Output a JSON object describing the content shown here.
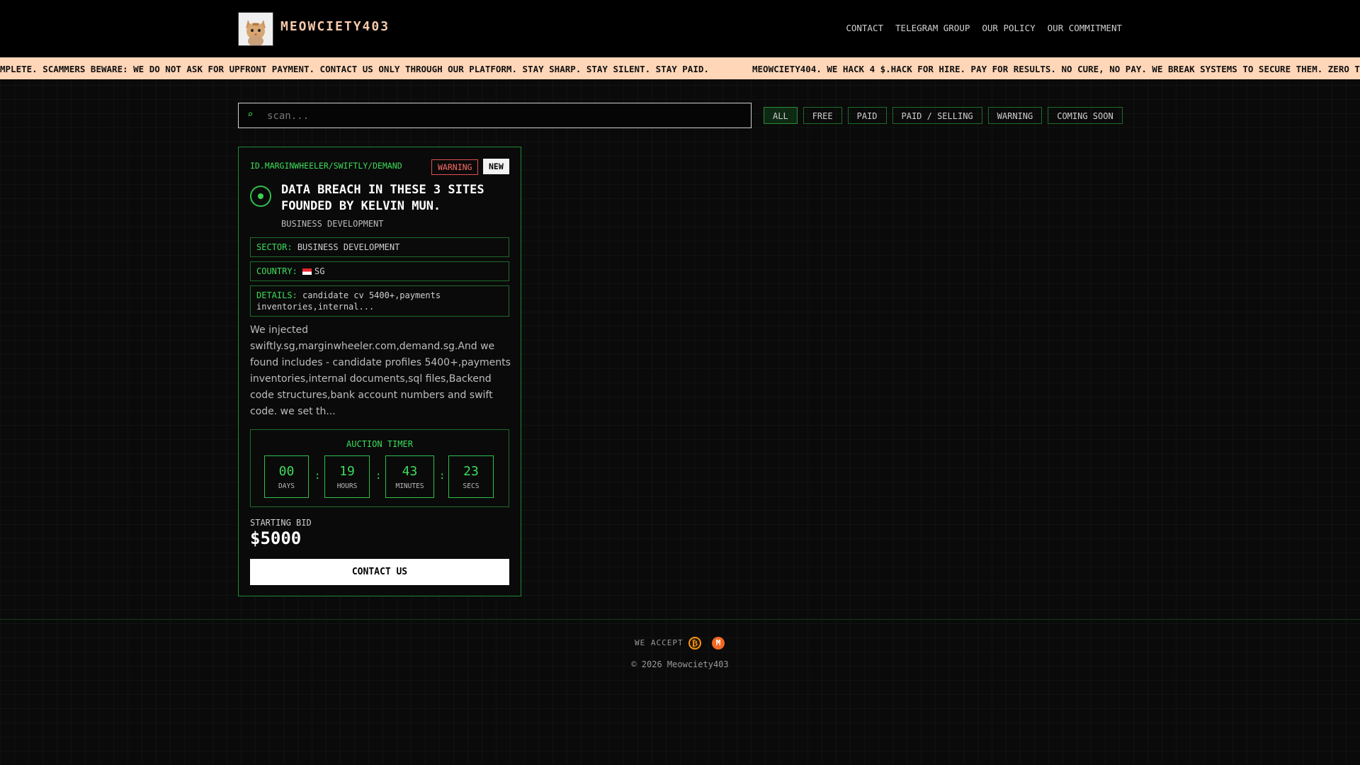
{
  "header": {
    "brand": "MEOWCIETY403",
    "nav": [
      "CONTACT",
      "TELEGRAM GROUP",
      "OUR POLICY",
      "OUR COMMITMENT"
    ]
  },
  "ticker": {
    "segment_1": "MPLETE. SCAMMERS BEWARE: WE DO NOT ASK FOR UPFRONT PAYMENT. CONTACT US ONLY THROUGH OUR PLATFORM. STAY SHARP. STAY SILENT. STAY PAID.",
    "segment_2": "MEOWCIETY404. WE HACK 4 $.HACK FOR HIRE. PAY FOR RESULTS. NO CURE, NO PAY. WE BREAK SYSTEMS TO SECURE THEM. ZERO T"
  },
  "search": {
    "placeholder": "scan...",
    "value": ""
  },
  "filters": [
    "ALL",
    "FREE",
    "PAID",
    "PAID / SELLING",
    "WARNING",
    "COMING SOON"
  ],
  "card": {
    "id": "ID.MARGINWHEELER/SWIFTLY/DEMAND",
    "tag_warning": "WARNING",
    "tag_new": "NEW",
    "title": "DATA BREACH IN THESE 3 SITES FOUNDED BY KELVIN MUN.",
    "subtitle": "BUSINESS DEVELOPMENT",
    "sector_label": "SECTOR:",
    "sector_value": "BUSINESS DEVELOPMENT",
    "country_label": "COUNTRY:",
    "country_value": "SG",
    "details_label": "DETAILS:",
    "details_value": "candidate cv 5400+,payments inventories,internal...",
    "description": "We injected swiftly.sg,marginwheeler.com,demand.sg.And we found includes - candidate profiles 5400+,payments inventories,internal documents,sql files,Backend code structures,bank account numbers and swift code. we set th...",
    "timer_label": "AUCTION TIMER",
    "timer": {
      "days": "00",
      "days_label": "DAYS",
      "hours": "19",
      "hours_label": "HOURS",
      "minutes": "43",
      "minutes_label": "MINUTES",
      "secs": "23",
      "secs_label": "SECS"
    },
    "bid_label": "STARTING BID",
    "bid_amount": "$5000",
    "contact_button": "CONTACT US"
  },
  "footer": {
    "accept_label": "WE ACCEPT",
    "coins": [
      "bitcoin-icon",
      "monero-icon"
    ],
    "copyright": "© 2026 Meowciety403"
  },
  "colors": {
    "accent_green": "#3ddc5a",
    "brand_peach": "#f6c9ab",
    "ticker_bg": "#ffd6b8",
    "warning_red": "#ff6b6b"
  }
}
